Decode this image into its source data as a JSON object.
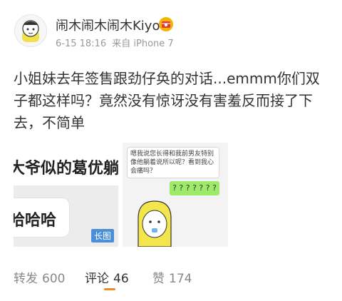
{
  "author": {
    "name": "闹木闹木闹木Kiyo",
    "time": "6-15 18:16",
    "source": "来自 iPhone 7"
  },
  "post": {
    "text": "小姐妹去年签售跟劲仔奂的对话...emmm你们双子都这样吗？竟然没有惊讶没有害羞反而接了下去，不简单"
  },
  "images": {
    "left_line1": "大爷似的葛优躺",
    "left_line2": "哈哈哈",
    "long_label": "长图",
    "right_chat": "嗯我说您长得和我前男友特别像他躺着说所以呢？看到我心会痛吗？",
    "right_reply": "? ? ? ? ? ? ?"
  },
  "actions": {
    "forward_label": "转发",
    "forward_count": "600",
    "comment_label": "评论",
    "comment_count": "46",
    "like_label": "赞",
    "like_count": "174"
  },
  "colors": {
    "accent": "#f08a24",
    "text": "#333333",
    "muted": "#999999",
    "long_badge": "#4a8fd8",
    "chat_green": "#9eea6a"
  }
}
